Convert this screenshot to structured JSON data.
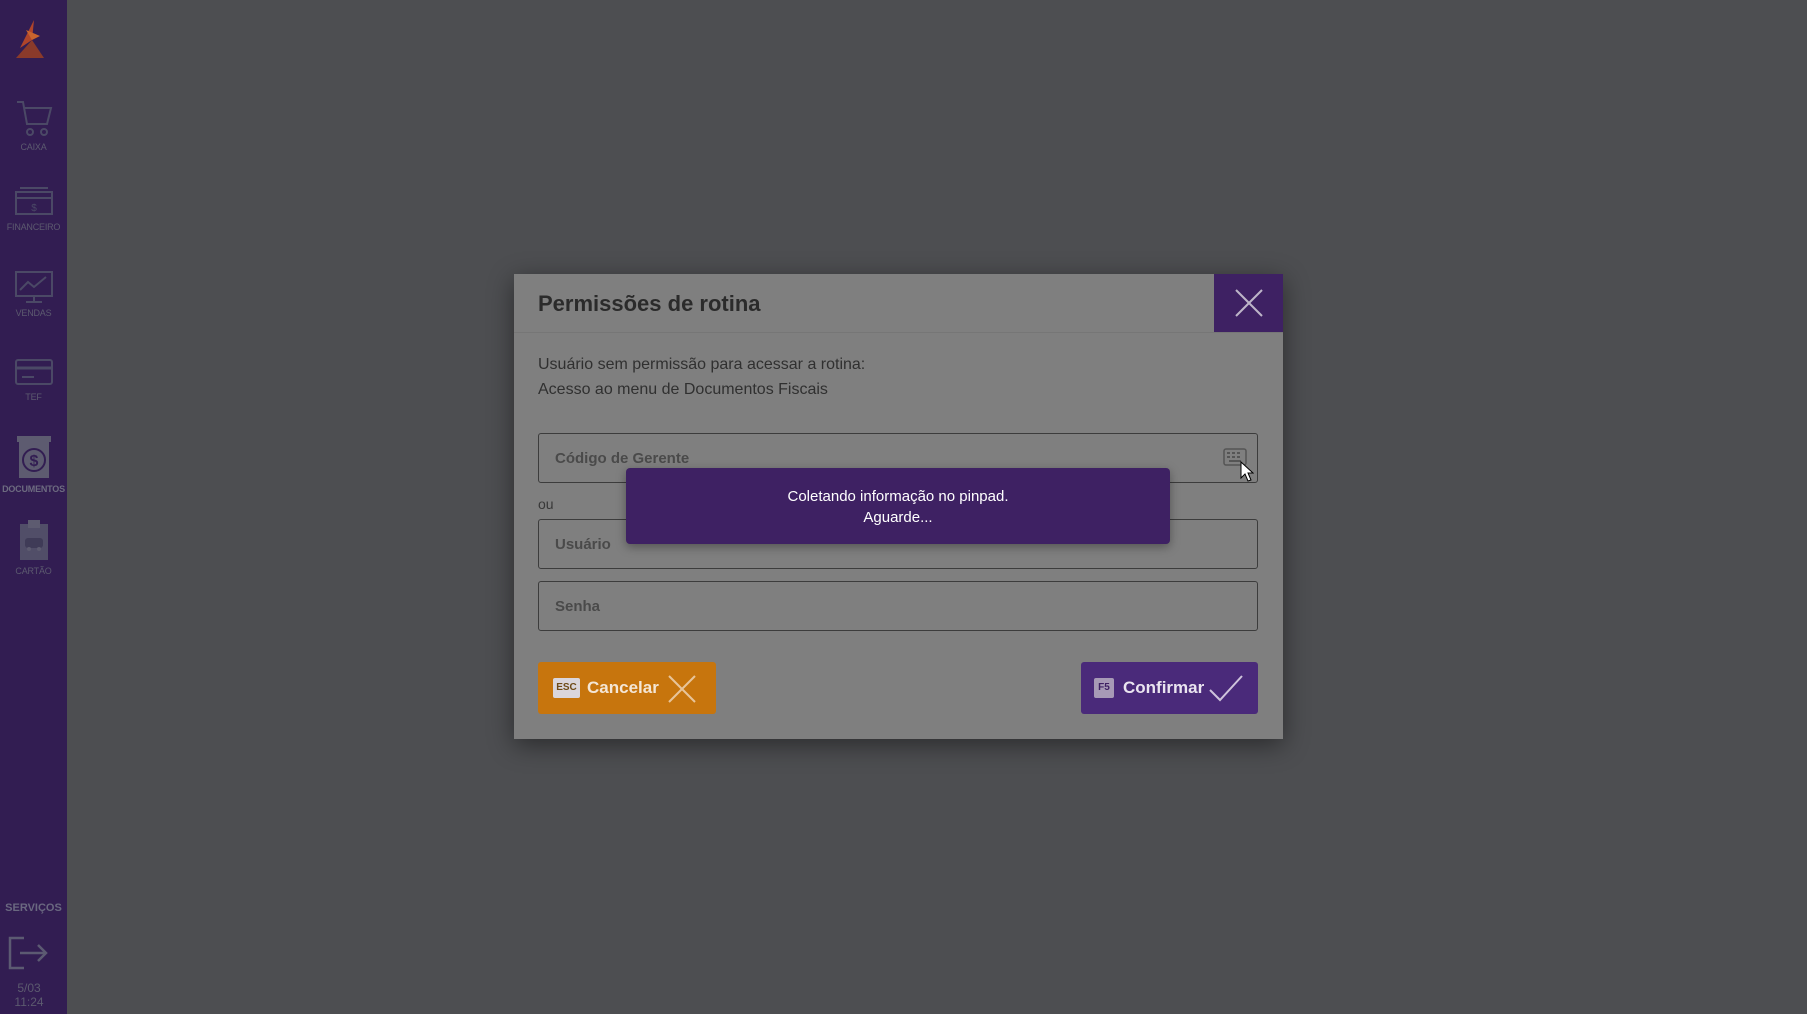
{
  "sidebar": {
    "items": [
      {
        "label": "Caixa",
        "icon": "cart-icon"
      },
      {
        "label": "Financeiro",
        "icon": "money-drawer-icon"
      },
      {
        "label": "Vendas",
        "icon": "chart-monitor-icon"
      },
      {
        "label": "TEF",
        "icon": "card-icon"
      },
      {
        "label": "Documentos",
        "icon": "dollar-document-icon",
        "active": true
      },
      {
        "label": "Cartão",
        "icon": "clipboard-car-icon"
      }
    ],
    "services_label": "SERVIÇOS",
    "logout_icon": "logout-icon",
    "date": "5/03",
    "time": "11:24"
  },
  "modal": {
    "title": "Permissões de rotina",
    "message_line1": "Usuário sem permissão para acessar a rotina:",
    "message_line2": "Acesso ao menu de Documentos Fiscais",
    "manager_code_placeholder": "Código de Gerente",
    "or_label": "ou",
    "user_placeholder": "Usuário",
    "password_placeholder": "Senha",
    "cancel": {
      "key": "ESC",
      "label": "Cancelar"
    },
    "confirm": {
      "key": "F5",
      "label": "Confirmar"
    }
  },
  "toast": {
    "line1": "Coletando informação no pinpad.",
    "line2": "Aguarde..."
  },
  "colors": {
    "sidebar": "#321d52",
    "accent_purple": "#3e2163",
    "cancel_orange": "#c7750d",
    "overlay": "#4d4e51"
  }
}
